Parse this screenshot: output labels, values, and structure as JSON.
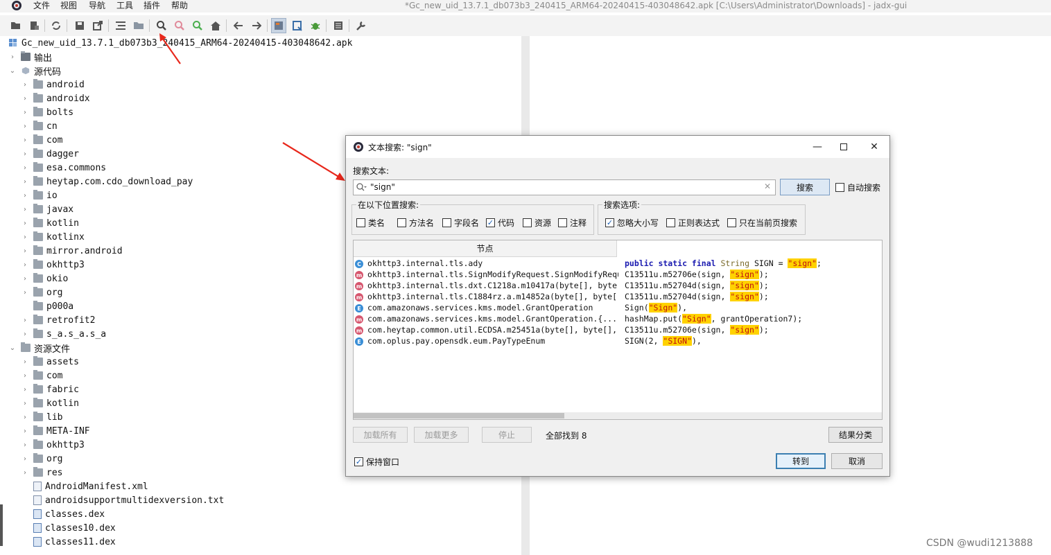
{
  "menubar": {
    "items": [
      "文件",
      "视图",
      "导航",
      "工具",
      "插件",
      "帮助"
    ],
    "window_title": "*Gc_new_uid_13.7.1_db073b3_240415_ARM64-20240415-403048642.apk [C:\\Users\\Administrator\\Downloads] - jadx-gui"
  },
  "toolbar": {
    "icons": [
      "open-file-icon",
      "add-files-icon",
      "sync-icon",
      "save-all-icon",
      "export-icon",
      "flatten-icon",
      "packages-icon",
      "search-icon",
      "class-search-icon",
      "usage-search-icon",
      "home-icon",
      "back-icon",
      "forward-icon",
      "quick-tabs-icon",
      "deobfuscation-icon",
      "debugger-icon",
      "log-icon",
      "preferences-icon"
    ]
  },
  "tree": {
    "root": "Gc_new_uid_13.7.1_db073b3_240415_ARM64-20240415-403048642.apk",
    "output": "输出",
    "source": "源代码",
    "source_items": [
      "android",
      "androidx",
      "bolts",
      "cn",
      "com",
      "dagger",
      "esa.commons",
      "heytap.com.cdo_download_pay",
      "io",
      "javax",
      "kotlin",
      "kotlinx",
      "mirror.android",
      "okhttp3",
      "okio",
      "org",
      "p000a",
      "retrofit2",
      "s_a.s_a.s_a"
    ],
    "resources": "资源文件",
    "resource_items": [
      "assets",
      "com",
      "fabric",
      "kotlin",
      "lib",
      "META-INF",
      "okhttp3",
      "org",
      "res"
    ],
    "files": [
      "AndroidManifest.xml",
      "androidsupportmultidexversion.txt",
      "classes.dex",
      "classes10.dex",
      "classes11.dex"
    ]
  },
  "dialog": {
    "title": "文本搜索: \"sign\"",
    "search_label": "搜索文本:",
    "search_value": "\"sign\"",
    "search_button": "搜索",
    "auto_search": {
      "label": "自动搜索",
      "checked": false
    },
    "scope": {
      "title": "在以下位置搜索:",
      "options": [
        {
          "label": "类名",
          "checked": false
        },
        {
          "label": "方法名",
          "checked": false
        },
        {
          "label": "字段名",
          "checked": false
        },
        {
          "label": "代码",
          "checked": true
        },
        {
          "label": "资源",
          "checked": false
        },
        {
          "label": "注释",
          "checked": false
        }
      ]
    },
    "options_group": {
      "title": "搜索选项:",
      "options": [
        {
          "label": "忽略大小写",
          "checked": true
        },
        {
          "label": "正则表达式",
          "checked": false
        },
        {
          "label": "只在当前页搜索",
          "checked": false
        }
      ]
    },
    "results_header": "节点",
    "results": [
      {
        "type": "C",
        "color": "#3a8ed6",
        "node": "okhttp3.internal.tls.ady",
        "code": [
          [
            "kw",
            "public static final "
          ],
          [
            "ty",
            "String"
          ],
          [
            "t",
            " SIGN = "
          ],
          [
            "hl",
            "\"sign\""
          ],
          [
            "t",
            ";"
          ]
        ]
      },
      {
        "type": "m",
        "color": "#d6566e",
        "node": "okhttp3.internal.tls.SignModifyRequest.SignModifyRequ",
        "code": [
          [
            "t",
            "C13511u.m52706e(sign, "
          ],
          [
            "hl",
            "\"sign\""
          ],
          [
            "t",
            ");"
          ]
        ]
      },
      {
        "type": "m",
        "color": "#d6566e",
        "node": "okhttp3.internal.tls.dxt.C1218a.m10417a(byte[], byte[",
        "code": [
          [
            "t",
            "C13511u.m52704d(sign, "
          ],
          [
            "hl",
            "\"sign\""
          ],
          [
            "t",
            ");"
          ]
        ]
      },
      {
        "type": "m",
        "color": "#d6566e",
        "node": "okhttp3.internal.tls.C1884rz.a.m14852a(byte[], byte[",
        "code": [
          [
            "t",
            "C13511u.m52704d(sign, "
          ],
          [
            "hl",
            "\"sign\""
          ],
          [
            "t",
            ");"
          ]
        ]
      },
      {
        "type": "E",
        "color": "#3a8ed6",
        "node": "com.amazonaws.services.kms.model.GrantOperation",
        "code": [
          [
            "t",
            "Sign("
          ],
          [
            "hl",
            "\"Sign\""
          ],
          [
            "t",
            "),"
          ]
        ]
      },
      {
        "type": "m",
        "color": "#d6566e",
        "node": "com.amazonaws.services.kms.model.GrantOperation.{...",
        "code": [
          [
            "t",
            "hashMap.put("
          ],
          [
            "hl",
            "\"Sign\""
          ],
          [
            "t",
            ", grantOperation7);"
          ]
        ]
      },
      {
        "type": "m",
        "color": "#d6566e",
        "node": "com.heytap.common.util.ECDSA.m25451a(byte[], byte[],",
        "code": [
          [
            "t",
            "C13511u.m52706e(sign, "
          ],
          [
            "hl",
            "\"sign\""
          ],
          [
            "t",
            ");"
          ]
        ]
      },
      {
        "type": "E",
        "color": "#3a8ed6",
        "node": "com.oplus.pay.opensdk.eum.PayTypeEnum",
        "code": [
          [
            "t",
            "SIGN(2, "
          ],
          [
            "hl",
            "\"SIGN\""
          ],
          [
            "t",
            "),"
          ]
        ]
      }
    ],
    "load_all": "加载所有",
    "load_more": "加载更多",
    "stop": "停止",
    "found_text": "全部找到  8",
    "group_results": "结果分类",
    "keep_window": {
      "label": "保持窗口",
      "checked": true
    },
    "goto_button": "转到",
    "cancel_button": "取消"
  },
  "watermark": "CSDN @wudi1213888"
}
